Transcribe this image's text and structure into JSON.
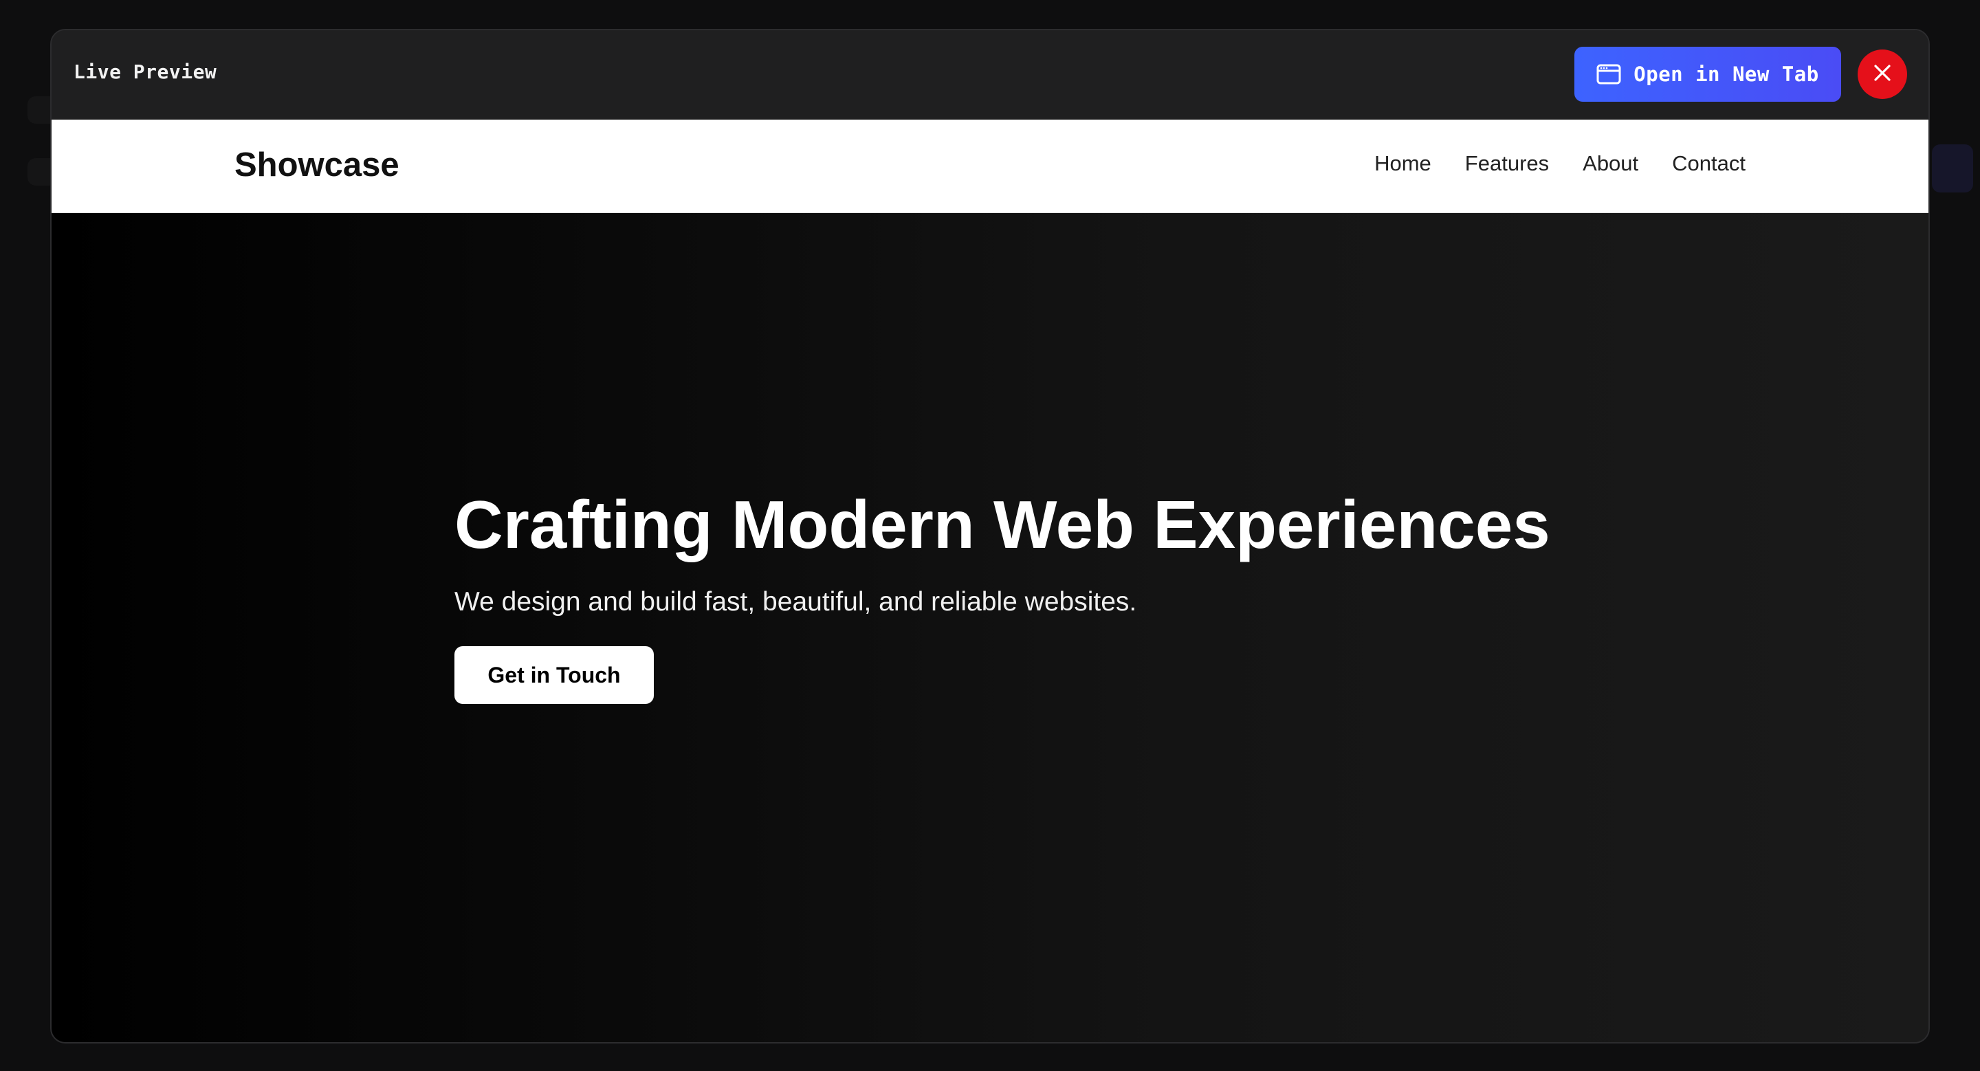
{
  "modal": {
    "title": "Live Preview",
    "open_tab_label": "Open in New Tab",
    "open_tab_icon": "browser-window-icon",
    "close_icon": "close-icon",
    "accent_color": "#4353f9",
    "close_color": "#e5101a"
  },
  "site": {
    "logo": "Showcase",
    "nav": [
      {
        "label": "Home"
      },
      {
        "label": "Features"
      },
      {
        "label": "About"
      },
      {
        "label": "Contact"
      }
    ],
    "hero": {
      "title": "Crafting Modern Web Experiences",
      "subtitle": "We design and build fast, beautiful, and reliable websites.",
      "cta_label": "Get in Touch"
    }
  }
}
